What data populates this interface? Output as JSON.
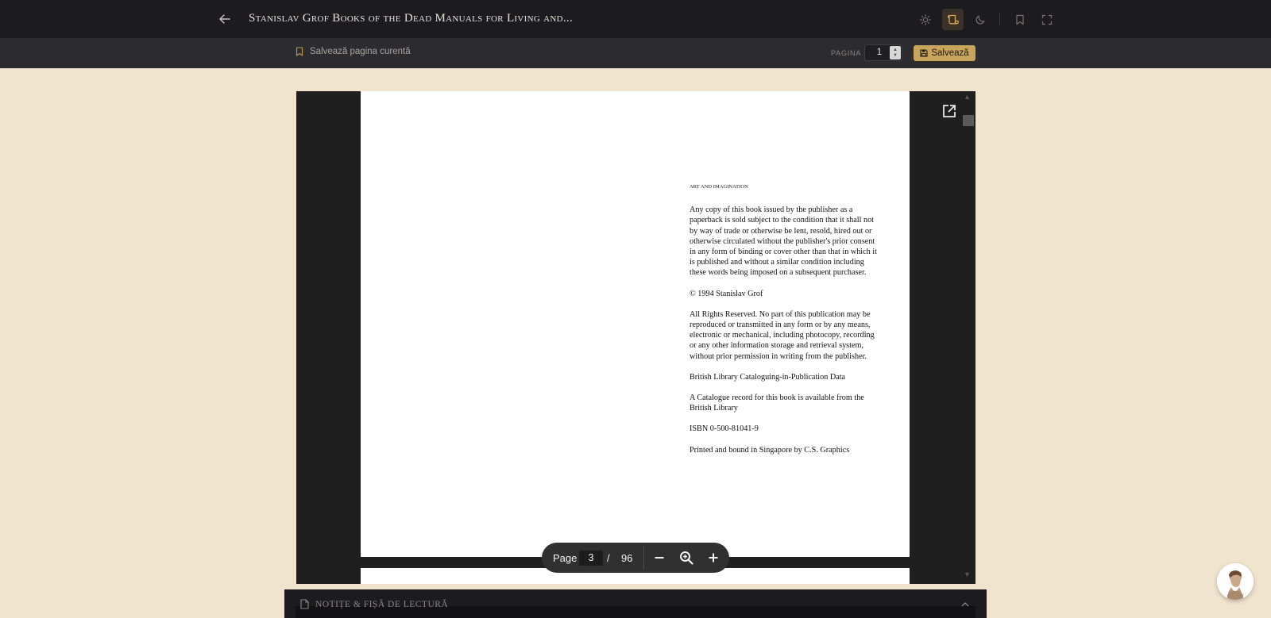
{
  "header": {
    "back_icon": "arrow-left-icon",
    "book_title": "Stanislav Grof Books of the Dead Manuals for Living and...",
    "tools": [
      {
        "name": "light-theme",
        "icon": "sun-icon",
        "active": false
      },
      {
        "name": "sepia-theme",
        "icon": "scroll-icon",
        "active": true
      },
      {
        "name": "dark-theme",
        "icon": "moon-icon",
        "active": false
      },
      {
        "name": "bookmark",
        "icon": "bookmark-icon",
        "active": false
      },
      {
        "name": "fullscreen",
        "icon": "fullscreen-icon",
        "active": false
      }
    ],
    "accent_color": "#c9a45c"
  },
  "subbar": {
    "save_current_label": "Salvează pagina curentă",
    "page_label": "PAGINA",
    "page_value": "1",
    "save_button_label": "Salvează"
  },
  "pdf": {
    "header": "ART AND IMAGINATION",
    "paragraphs": [
      "Any copy of this book issued by the publisher as a paperback is sold subject to the condition that it shall not by way of trade or otherwise be lent, resold, hired out or otherwise circulated without the publisher's prior consent in any form of binding or cover other than that in which it is published and without a similar condition including these words being imposed on a subsequent purchaser.",
      "© 1994 Stanislav Grof",
      "All Rights Reserved. No part of this publication may be reproduced or transmitted in any form or by any means, electronic or mechanical, including photocopy, recording or any other information storage and retrieval system, without prior permission in writing from the publisher.",
      "British Library Cataloguing-in-Publication Data",
      "A Catalogue record for this book is available from the British Library",
      "ISBN 0-500-81041-9",
      "Printed and bound in Singapore by C.S. Graphics"
    ],
    "toolbar": {
      "page_label": "Page",
      "current_page": "3",
      "separator": "/",
      "total_pages": "96"
    }
  },
  "notes": {
    "title": "NOTIȚE & FIȘĂ DE LECTURĂ"
  }
}
